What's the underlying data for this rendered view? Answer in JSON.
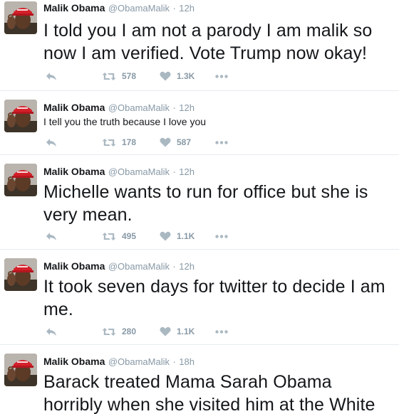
{
  "tweets": [
    {
      "name": "Malik Obama",
      "handle": "@ObamaMalik",
      "separator": "·",
      "time": "12h",
      "text": "I told you I am not a parody I am malik so now I am verified. Vote Trump now okay!",
      "retweets": "578",
      "likes": "1.3K"
    },
    {
      "name": "Malik Obama",
      "handle": "@ObamaMalik",
      "separator": "·",
      "time": "12h",
      "text": "I tell you the truth because I love you",
      "retweets": "178",
      "likes": "587"
    },
    {
      "name": "Malik Obama",
      "handle": "@ObamaMalik",
      "separator": "·",
      "time": "12h",
      "text": "Michelle wants to run for office but she is very mean.",
      "retweets": "495",
      "likes": "1.1K"
    },
    {
      "name": "Malik Obama",
      "handle": "@ObamaMalik",
      "separator": "·",
      "time": "12h",
      "text": "It took seven days for twitter to decide I am me.",
      "retweets": "280",
      "likes": "1.1K"
    },
    {
      "name": "Malik Obama",
      "handle": "@ObamaMalik",
      "separator": "·",
      "time": "18h",
      "text": "Barack treated Mama Sarah Obama horribly when she visited him at the White",
      "retweets": "",
      "likes": ""
    }
  ],
  "icons": {
    "reply": "reply-icon",
    "retweet": "retweet-icon",
    "like": "heart-icon",
    "more": "more-icon"
  },
  "colors": {
    "text": "#14171a",
    "muted": "#8899a6",
    "icon": "#aab8c2",
    "divider": "#e6ecf0",
    "hat": "#d4202a"
  }
}
